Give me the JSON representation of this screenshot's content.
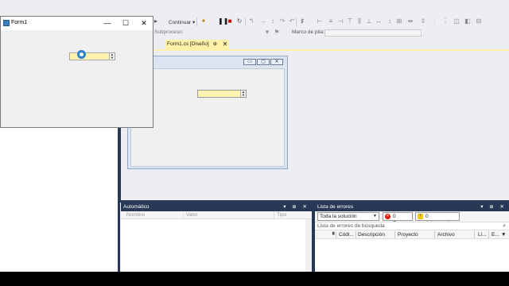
{
  "form1_window": {
    "title": "Form1",
    "minimize": "—",
    "maximize": "☐",
    "close": "✕"
  },
  "toolbar": {
    "continuar": "Continuar ▾",
    "subproceso": "Subproceso:",
    "marco_label": "Marco de pila:"
  },
  "document_tab": {
    "label": "Form1.cs [Diseño]",
    "pin": "⊕",
    "close": "✕"
  },
  "designer_form": {
    "minimize": "▭",
    "maximize": "▢",
    "close": "✕"
  },
  "automatico_panel": {
    "title": "Automático",
    "tools": "▾ ⊕ ✕",
    "columns": [
      "Nombre",
      "Valor",
      "Tipo"
    ]
  },
  "errores_panel": {
    "title": "Lista de errores",
    "tools": "▾ ⊕ ✕",
    "scope": "Toda la solución",
    "errors_btn": "0 Errores",
    "warnings_btn": "0 Advertencias",
    "search_placeholder": "Lista de errores de búsqueda",
    "columns": [
      "Códi...",
      "Descripción",
      "Proyecto",
      "Archivo",
      "Lí...",
      "E..."
    ]
  },
  "colors": {
    "accent_dark": "#293955",
    "highlight_yellow": "#fff1a8",
    "error_red": "#e51400",
    "warning_yellow": "#f2c811"
  }
}
